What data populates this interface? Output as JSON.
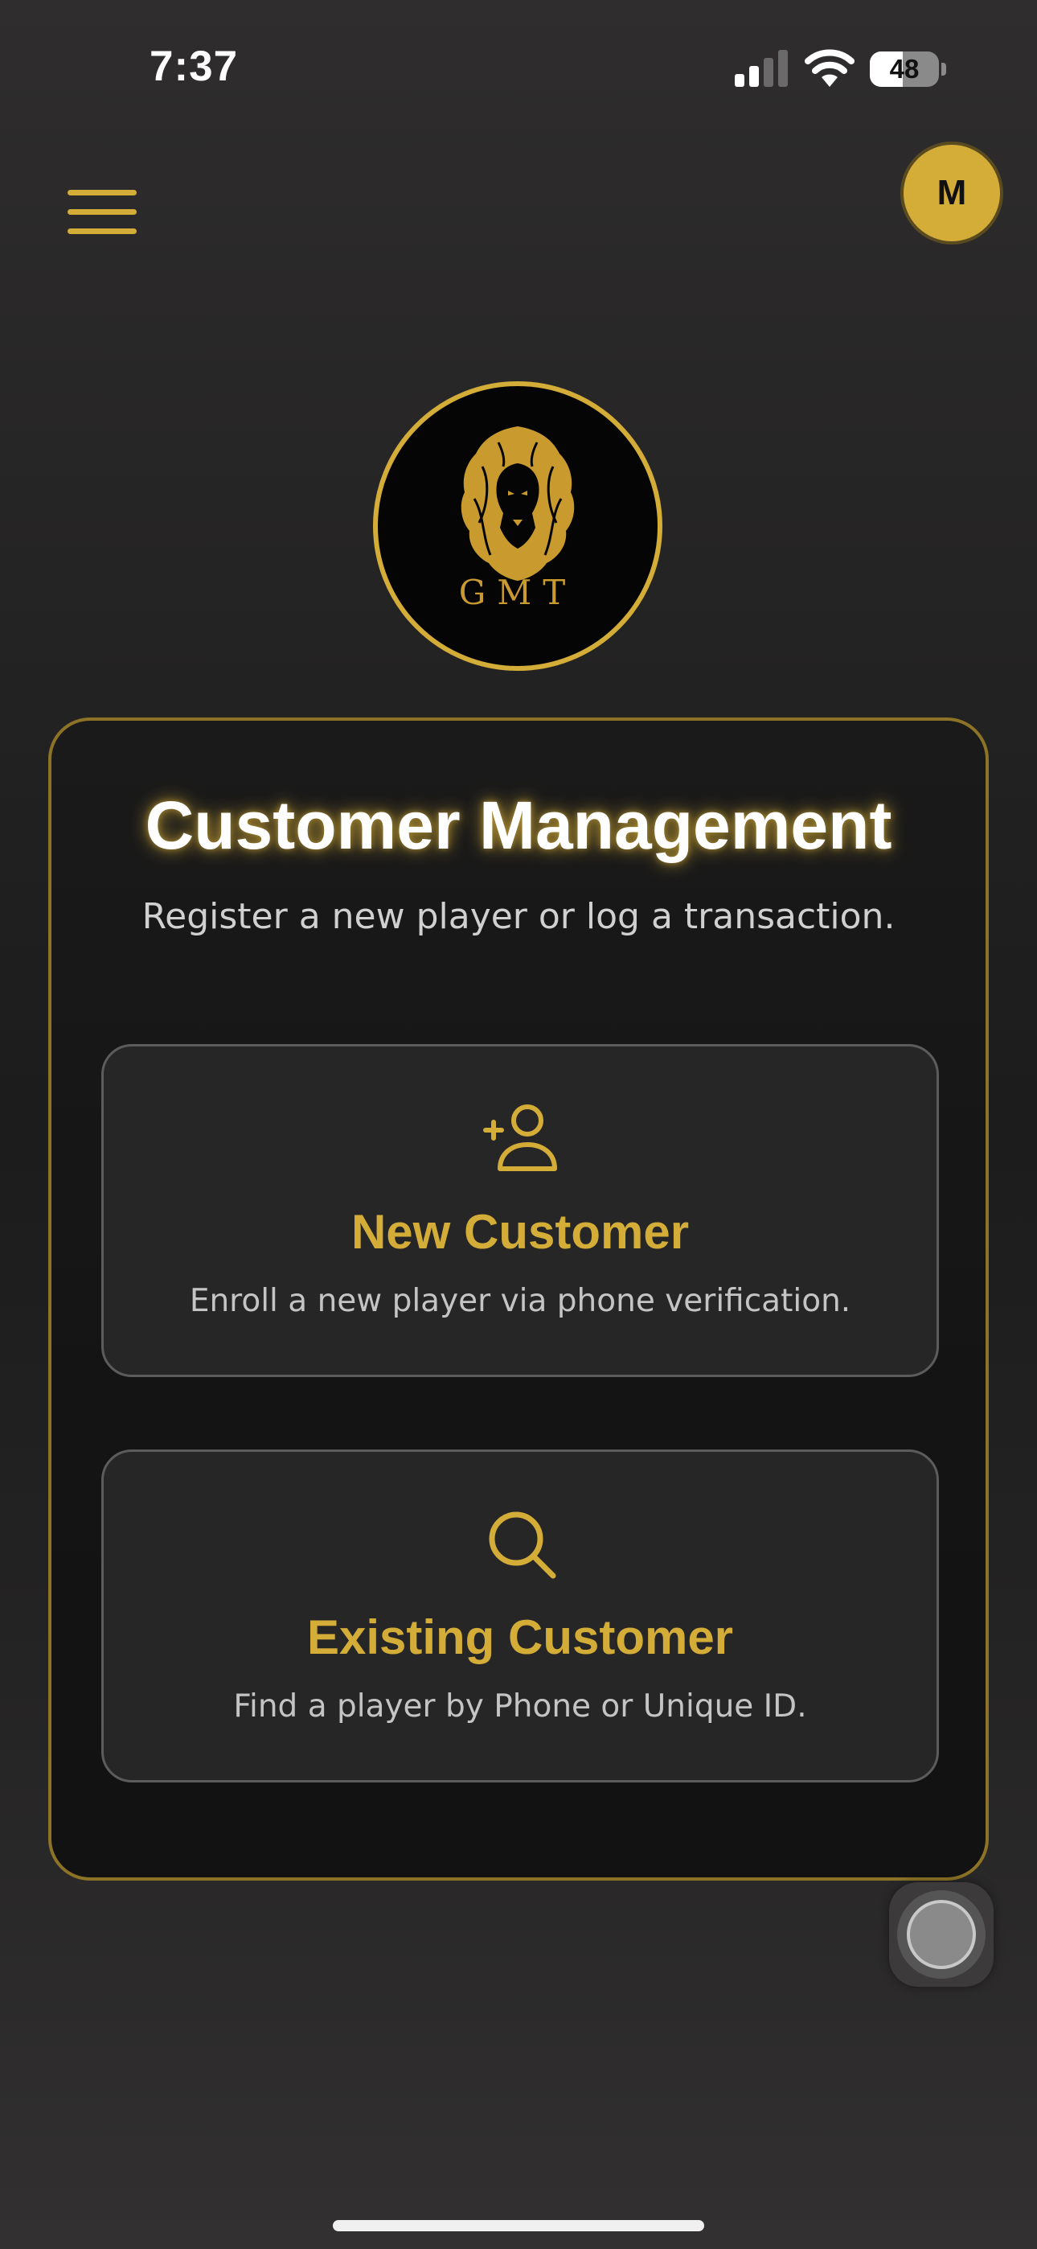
{
  "status_bar": {
    "time": "7:37",
    "battery_percent": "48",
    "battery_level": 0.48,
    "signal_bars_active": 2
  },
  "header": {
    "menu_icon": "hamburger-menu-icon",
    "avatar_initial": "M"
  },
  "logo": {
    "emblem": "lion-head",
    "text": "GMT"
  },
  "card": {
    "title": "Customer Management",
    "subtitle": "Register a new player or log a transaction.",
    "options": [
      {
        "icon": "user-add-icon",
        "title": "New Customer",
        "description": "Enroll a new player via phone verification."
      },
      {
        "icon": "search-icon",
        "title": "Existing Customer",
        "description": "Find a player by Phone or Unique ID."
      }
    ]
  },
  "colors": {
    "accent_gold": "#d4ac38",
    "background": "#2a2828",
    "card_border": "#8c7326"
  }
}
